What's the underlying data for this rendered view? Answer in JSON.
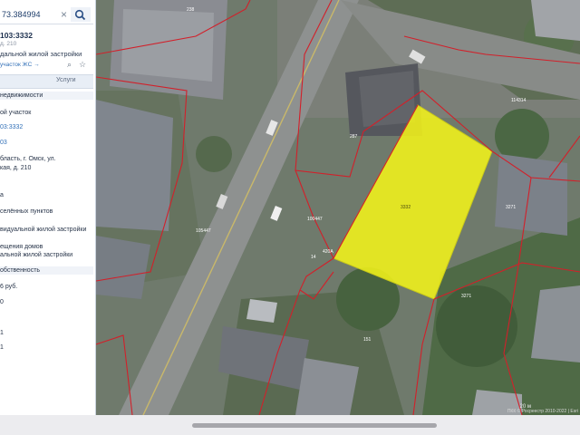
{
  "search": {
    "value": "73.384994"
  },
  "card": {
    "cad_number": "103:3332",
    "address_short": "д. 210",
    "type_line": "дальной жилой застройки",
    "link_text": "участок ЖС →"
  },
  "tabs": {
    "services": "Услуги"
  },
  "details": [
    "недвижимости",
    "ой участок",
    "03:3332",
    "03",
    "бласть, г. Омск, ул.",
    "кая, д. 210",
    "а",
    "селённых пунктов",
    "видуальной жилой застройки",
    "ещения домов",
    "альной жилой застройки",
    "обственность",
    "6 руб.",
    "0",
    "1",
    "1"
  ],
  "map": {
    "parcel_color": "#f2f21a",
    "boundary_color": "#d2202a",
    "labels": [
      "238",
      "3332",
      "287",
      "114314",
      "3271",
      "3271",
      "14",
      "420A",
      "151",
      "105447",
      "100447"
    ],
    "scale_text": "20 м",
    "attribution": "ПКК © Росреестр 2010-2022 | Esri"
  }
}
